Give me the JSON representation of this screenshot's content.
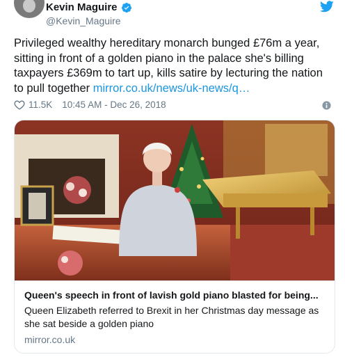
{
  "tweet": {
    "display_name": "Kevin Maguire",
    "handle": "@Kevin_Maguire",
    "text": "Privileged wealthy hereditary monarch bunged £76m a year, sitting in front of a golden piano in the palace she's billing taxpayers £369m to tart up, kills satire by lecturing the nation to pull together ",
    "link": "mirror.co.uk/news/uk-news/q…",
    "likes": "11.5K",
    "timestamp": "10:45 AM - Dec 26, 2018"
  },
  "card": {
    "title": "Queen's speech in front of lavish gold piano blasted for being...",
    "description": "Queen Elizabeth referred to Brexit in her Christmas day message as she sat beside a golden piano",
    "domain": "mirror.co.uk"
  },
  "icons": {
    "verified": "verified-badge-icon",
    "twitter": "twitter-bird-icon",
    "like": "heart-icon",
    "info": "info-icon"
  },
  "colors": {
    "accent": "#1da1f2",
    "link": "#1b95e0",
    "muted": "#657786",
    "border": "#e1e8ed"
  }
}
